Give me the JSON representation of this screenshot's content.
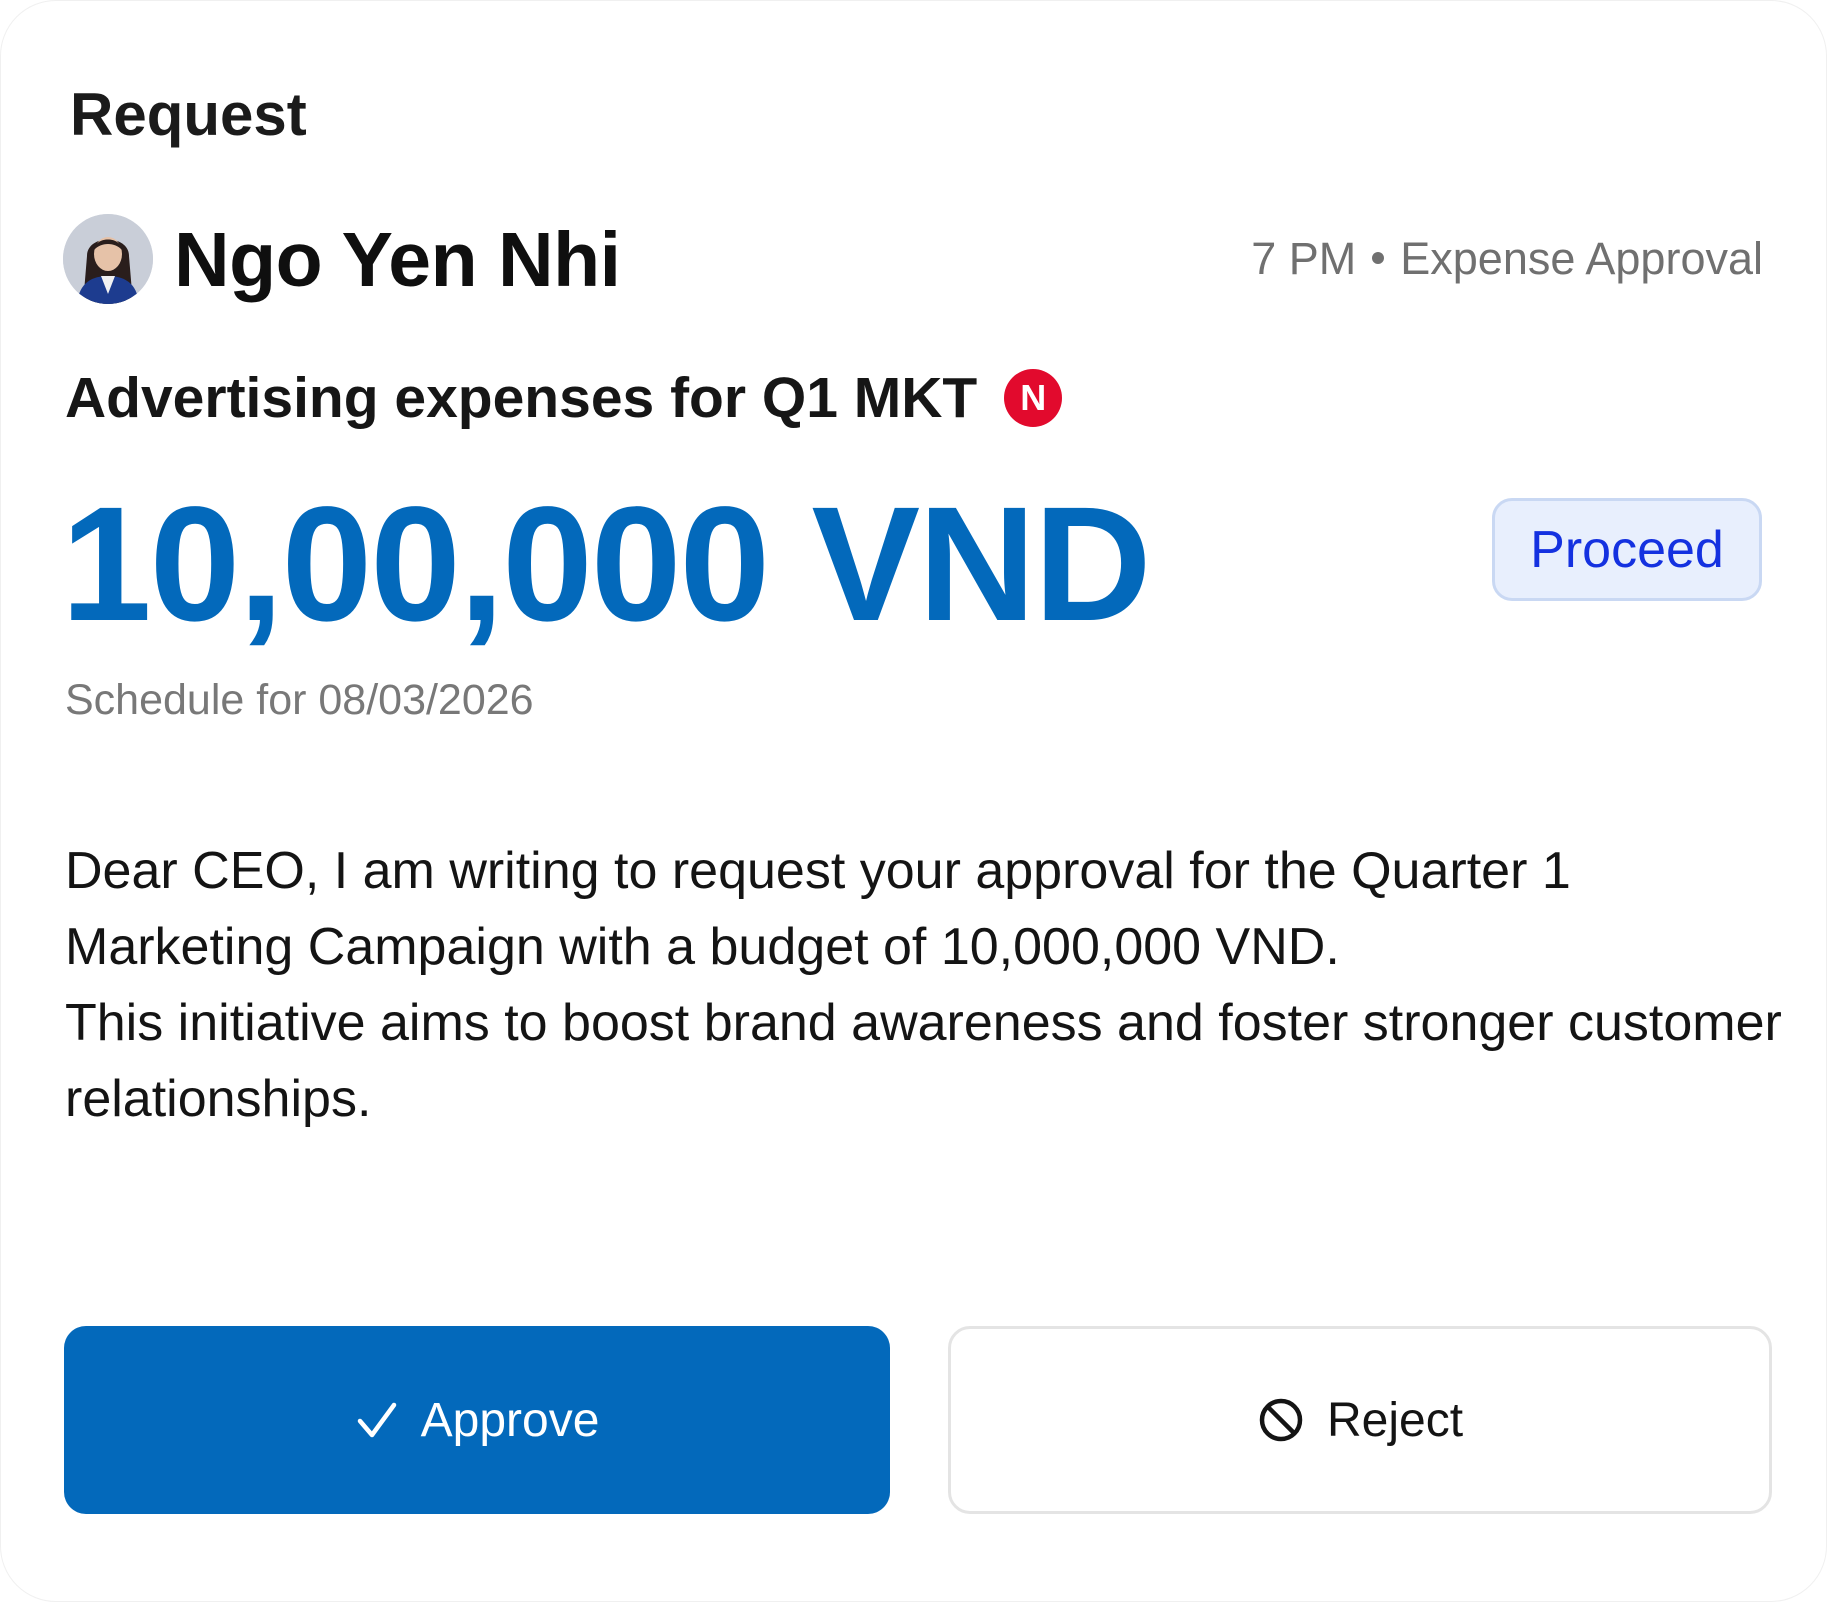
{
  "card": {
    "title": "Request"
  },
  "sender": {
    "name": "Ngo Yen Nhi",
    "avatar_icon": "profile-photo",
    "time": "7 PM",
    "category": "Expense Approval"
  },
  "request": {
    "subject": "Advertising expenses for Q1 MKT",
    "new_badge": "N",
    "amount": "10,00,000 VND",
    "status": "Proceed",
    "schedule": "Schedule for 08/03/2026",
    "message_lines": [
      "Dear CEO, I am writing to request your approval for the Quarter 1 Marketing Campaign with a budget of 10,000,000 VND.",
      "This initiative aims to boost brand awareness and foster stronger customer relationships."
    ]
  },
  "actions": {
    "approve_label": "Approve",
    "approve_icon": "checkmark-icon",
    "reject_label": "Reject",
    "reject_icon": "block-icon"
  },
  "colors": {
    "accent": "#0369bb",
    "badge_red": "#e20a2d",
    "status_text": "#1431e0",
    "status_bg": "#e8effd"
  }
}
